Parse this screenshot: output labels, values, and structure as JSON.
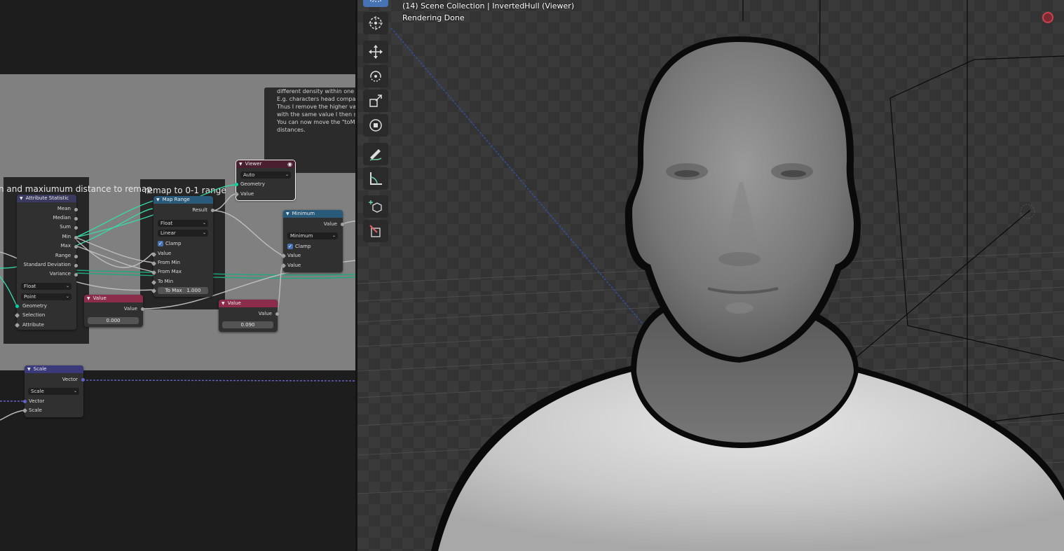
{
  "node_editor": {
    "frame_labels": {
      "left": "n and maxiumum distance to remap",
      "right": "remap to 0-1 range"
    },
    "note_lines": [
      "different density within one",
      "E.g. characters head compa",
      "Thus I remove the higher va",
      "with the same value I then s",
      "You can now move the \"toM",
      "distances."
    ],
    "attribute_statistic": {
      "title": "Attribute Statistic",
      "outputs": [
        "Mean",
        "Median",
        "Sum",
        "Min",
        "Max",
        "Range",
        "Standard Deviation",
        "Variance"
      ],
      "type": "Float",
      "domain": "Point",
      "inputs": [
        "Geometry",
        "Selection",
        "Attribute"
      ]
    },
    "map_range": {
      "title": "Map Range",
      "output": "Result",
      "type": "Float",
      "interpolation": "Linear",
      "clamp_label": "Clamp",
      "inputs": [
        "Value",
        "From Min",
        "From Max",
        "To Min"
      ],
      "to_max_label": "To Max",
      "to_max_value": "1.000"
    },
    "viewer": {
      "title": "Viewer",
      "domain": "Auto",
      "inputs": [
        "Geometry",
        "Value"
      ]
    },
    "minimum": {
      "title": "Minimum",
      "output": "Value",
      "operation": "Minimum",
      "clamp_label": "Clamp",
      "inputs": [
        "Value",
        "Value"
      ]
    },
    "value_a": {
      "title": "Value",
      "output": "Value",
      "value": "0.000"
    },
    "value_b": {
      "title": "Value",
      "output": "Value",
      "value": "0.090"
    },
    "scale": {
      "title": "Scale",
      "output": "Vector",
      "mode": "Scale",
      "inputs": [
        "Vector",
        "Scale"
      ]
    }
  },
  "viewport": {
    "header_line": "(14) Scene Collection | InvertedHull (Viewer)",
    "status": "Rendering Done",
    "tools": [
      "select-box-icon",
      "cursor-icon",
      "move-icon",
      "rotate-icon",
      "scale-icon",
      "transform-icon",
      "annotate-icon",
      "measure-icon",
      "add-cube-icon",
      "knife-icon"
    ]
  },
  "colors": {
    "geometry_socket": "#00d6a3",
    "vector_socket": "#6363c7",
    "float_socket": "#a1a1a1",
    "selected_tool": "#4772b3",
    "record_indicator": "#d0404c"
  }
}
